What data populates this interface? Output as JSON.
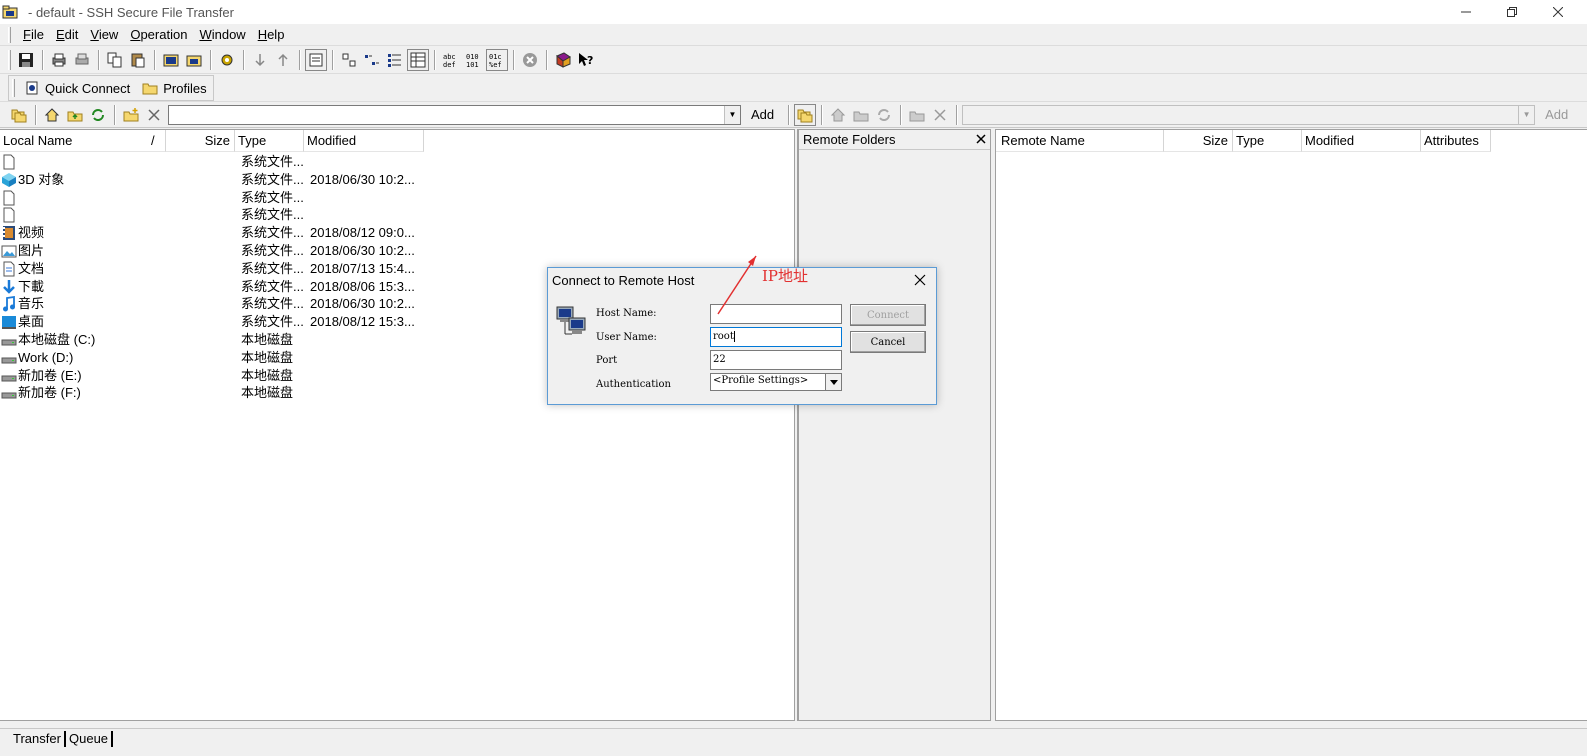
{
  "window": {
    "title": " - default - SSH Secure File Transfer"
  },
  "menu": [
    {
      "label": "File",
      "u": "F",
      "rest": "ile"
    },
    {
      "label": "Edit",
      "u": "E",
      "rest": "dit"
    },
    {
      "label": "View",
      "u": "V",
      "rest": "iew"
    },
    {
      "label": "Operation",
      "u": "O",
      "rest": "peration"
    },
    {
      "label": "Window",
      "u": "W",
      "rest": "indow"
    },
    {
      "label": "Help",
      "u": "H",
      "rest": "elp"
    }
  ],
  "quickbar": {
    "quick_connect": "Quick Connect",
    "profiles": "Profiles"
  },
  "local": {
    "add_label": "Add",
    "columns": {
      "name": "Local Name",
      "sort": "/",
      "size": "Size",
      "type": "Type",
      "modified": "Modified"
    },
    "rows": [
      {
        "name": "",
        "type": "系统文件...",
        "modified": "",
        "icon": "blank-file-icon"
      },
      {
        "name": "3D 对象",
        "type": "系统文件...",
        "modified": "2018/06/30 10:2...",
        "icon": "3d-objects-icon"
      },
      {
        "name": "",
        "type": "系统文件...",
        "modified": "",
        "icon": "blank-file-icon"
      },
      {
        "name": "",
        "type": "系统文件...",
        "modified": "",
        "icon": "blank-file-icon"
      },
      {
        "name": "视频",
        "type": "系统文件...",
        "modified": "2018/08/12 09:0...",
        "icon": "video-icon"
      },
      {
        "name": "图片",
        "type": "系统文件...",
        "modified": "2018/06/30 10:2...",
        "icon": "picture-icon"
      },
      {
        "name": "文档",
        "type": "系统文件...",
        "modified": "2018/07/13 15:4...",
        "icon": "document-icon"
      },
      {
        "name": "下載",
        "type": "系统文件...",
        "modified": "2018/08/06 15:3...",
        "icon": "download-icon"
      },
      {
        "name": "音乐",
        "type": "系统文件...",
        "modified": "2018/06/30 10:2...",
        "icon": "music-icon"
      },
      {
        "name": "桌面",
        "type": "系统文件...",
        "modified": "2018/08/12 15:3...",
        "icon": "desktop-icon"
      },
      {
        "name": "本地磁盘 (C:)",
        "type": "本地磁盘",
        "modified": "",
        "icon": "drive-icon"
      },
      {
        "name": "Work (D:)",
        "type": "本地磁盘",
        "modified": "",
        "icon": "drive-icon"
      },
      {
        "name": "新加卷 (E:)",
        "type": "本地磁盘",
        "modified": "",
        "icon": "drive-icon"
      },
      {
        "name": "新加卷 (F:)",
        "type": "本地磁盘",
        "modified": "",
        "icon": "drive-icon"
      }
    ]
  },
  "remote": {
    "add_label": "Add",
    "folders_title": "Remote Folders",
    "columns": {
      "name": "Remote Name",
      "size": "Size",
      "type": "Type",
      "modified": "Modified",
      "attributes": "Attributes"
    }
  },
  "status": {
    "transfer": "Transfer",
    "queue": "Queue"
  },
  "dialog": {
    "title": "Connect to Remote Host",
    "host_label": "Host Name:",
    "host_value": "",
    "user_label": "User Name:",
    "user_value": "root",
    "port_label": "Port",
    "port_value": "22",
    "auth_label": "Authentication",
    "auth_value": "<Profile Settings>",
    "connect": "Connect",
    "cancel": "Cancel"
  },
  "annotation": {
    "text": "IP地址",
    "color": "#e23030"
  }
}
